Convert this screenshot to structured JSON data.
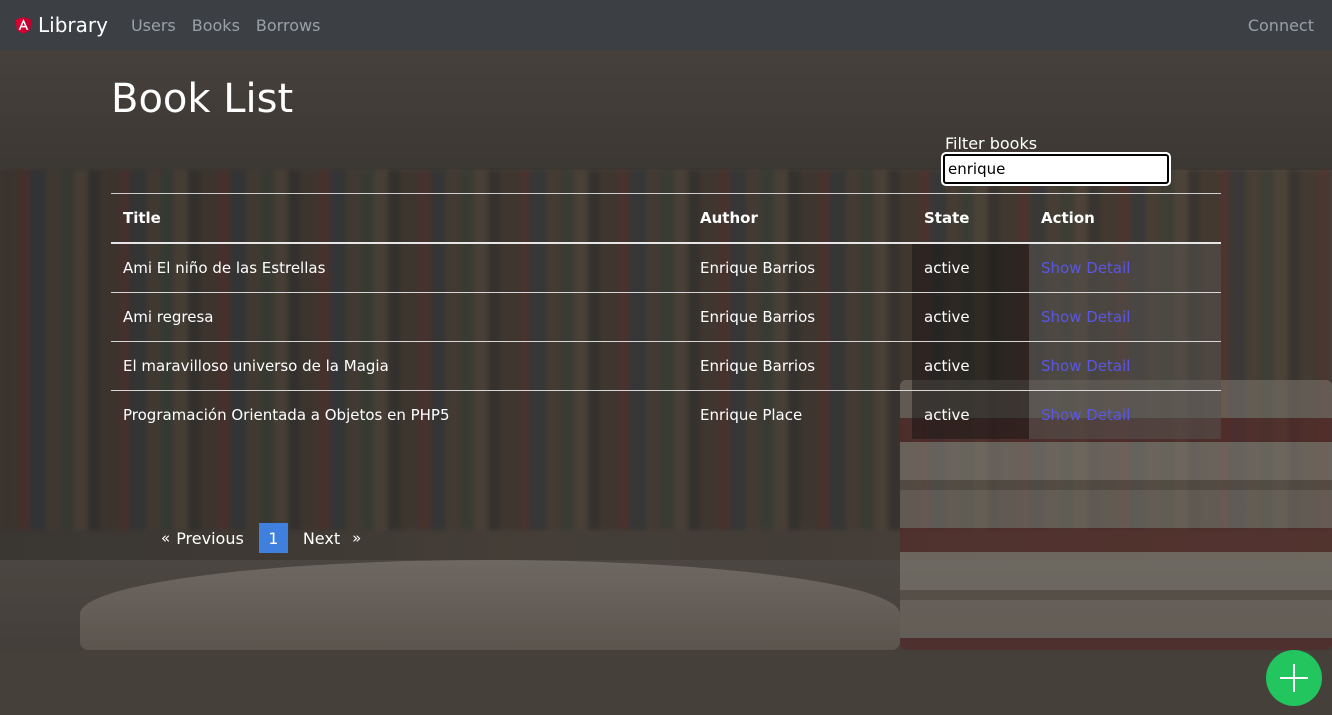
{
  "navbar": {
    "brand": "Library",
    "links": [
      "Users",
      "Books",
      "Borrows"
    ],
    "right_link": "Connect"
  },
  "page": {
    "title": "Book List"
  },
  "filter": {
    "label": "Filter books",
    "value": "enrique"
  },
  "table": {
    "headers": [
      "Title",
      "Author",
      "State",
      "Action"
    ],
    "rows": [
      {
        "title": "Ami El niño de las Estrellas",
        "author": "Enrique Barrios",
        "state": "active",
        "action": "Show Detail"
      },
      {
        "title": "Ami regresa",
        "author": "Enrique Barrios",
        "state": "active",
        "action": "Show Detail"
      },
      {
        "title": "El maravilloso universo de la Magia",
        "author": "Enrique Barrios",
        "state": "active",
        "action": "Show Detail"
      },
      {
        "title": "Programación Orientada a Objetos en PHP5",
        "author": "Enrique Place",
        "state": "active",
        "action": "Show Detail"
      }
    ]
  },
  "pagination": {
    "prev_arrow": "«",
    "prev": "Previous",
    "current": "1",
    "next": "Next",
    "next_arrow": "»"
  },
  "colors": {
    "navbar": "#3c3f44",
    "fab": "#22c55e",
    "link": "#5a56e6",
    "page_active": "#3f7fde",
    "brand_logo": "#dd0031"
  },
  "icons": {
    "brand": "angular-logo-icon",
    "fab": "plus-icon"
  }
}
